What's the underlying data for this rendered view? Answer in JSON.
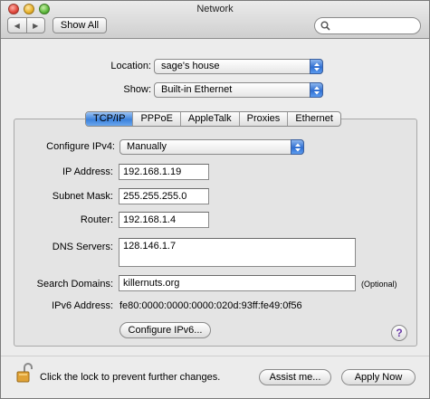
{
  "window": {
    "title": "Network"
  },
  "toolbar": {
    "back_glyph": "◀",
    "forward_glyph": "▶",
    "show_all_label": "Show All",
    "search_placeholder": ""
  },
  "location": {
    "label": "Location:",
    "value": "sage's house"
  },
  "show": {
    "label": "Show:",
    "value": "Built-in Ethernet"
  },
  "tabs": [
    {
      "label": "TCP/IP",
      "active": true
    },
    {
      "label": "PPPoE",
      "active": false
    },
    {
      "label": "AppleTalk",
      "active": false
    },
    {
      "label": "Proxies",
      "active": false
    },
    {
      "label": "Ethernet",
      "active": false
    }
  ],
  "tcpip": {
    "configure_label": "Configure IPv4:",
    "configure_value": "Manually",
    "ip_label": "IP Address:",
    "ip_value": "192.168.1.19",
    "subnet_label": "Subnet Mask:",
    "subnet_value": "255.255.255.0",
    "router_label": "Router:",
    "router_value": "192.168.1.4",
    "dns_label": "DNS Servers:",
    "dns_value": "128.146.1.7",
    "search_label": "Search Domains:",
    "search_value": "killernuts.org",
    "optional_label": "(Optional)",
    "ipv6_label": "IPv6 Address:",
    "ipv6_value": "fe80:0000:0000:0000:020d:93ff:fe49:0f56",
    "configure_ipv6_label": "Configure IPv6...",
    "help_label": "?"
  },
  "footer": {
    "lock_text": "Click the lock to prevent further changes.",
    "assist_label": "Assist me...",
    "apply_label": "Apply Now"
  },
  "icons": [
    "close-button",
    "minimize-button",
    "zoom-button",
    "back-icon",
    "forward-icon",
    "search-icon",
    "popup-arrows-icon",
    "lock-icon",
    "help-icon"
  ]
}
